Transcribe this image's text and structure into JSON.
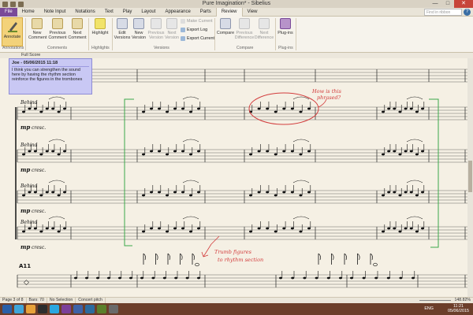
{
  "window": {
    "title": "Pure Imagination* - Sibelius",
    "controls": [
      "—",
      "□",
      "✕"
    ]
  },
  "tabs": [
    "File",
    "Home",
    "Note Input",
    "Notations",
    "Text",
    "Play",
    "Layout",
    "Appearance",
    "Parts",
    "Review",
    "View"
  ],
  "active_tab": "Review",
  "search": {
    "placeholder": "Find in ribbon"
  },
  "ribbon": {
    "annotate": "Annotate",
    "new_comment": [
      "New",
      "Comment"
    ],
    "previous_comment": [
      "Previous",
      "Comment"
    ],
    "next_comment": [
      "Next",
      "Comment"
    ],
    "highlight": "Highlight",
    "edit_versions": [
      "Edit",
      "Versions"
    ],
    "new_version": [
      "New",
      "Version"
    ],
    "previous_version": [
      "Previous",
      "Version"
    ],
    "next_version": [
      "Next",
      "Version"
    ],
    "make_current": "Make Current",
    "export_log": "Export Log",
    "export_current": "Export Current",
    "compare": "Compare",
    "previous_difference": [
      "Previous",
      "Difference"
    ],
    "next_difference": [
      "Next",
      "Difference"
    ],
    "plugins": "Plug-ins",
    "groups": [
      "Annotations",
      "Comments",
      "Highlights",
      "Versions",
      "Compare",
      "Plug-ins"
    ]
  },
  "document_tab": "Full Score",
  "comment": {
    "author_date": "Joe - 05/06/2015 11:18",
    "text": "I think you can strengthen the sound here by having the rhythm section reinforce the figures in the trombones"
  },
  "score": {
    "staff_directions": [
      "Behind",
      "Behind",
      "Behind",
      "Behind"
    ],
    "dynamics": [
      "mp",
      "cresc."
    ],
    "rehearsal_mark": "A11",
    "annotations": {
      "question": [
        "How is this",
        "phrased?"
      ],
      "instruction": [
        "Trumb figures",
        "to rhythm section"
      ]
    }
  },
  "status": {
    "page": "Page 3 of 8",
    "bars": "Bars: 70",
    "selection": "No Selection",
    "pitch": "Concert pitch",
    "zoom": "148.82%"
  },
  "taskbar": {
    "time": "11:21",
    "date": "05/06/2015",
    "lang": "ENG",
    "colors": [
      "#2a5fa8",
      "#3fa5d9",
      "#e8a23a",
      "#2d2d2d",
      "#2aa7e0",
      "#7b3f99",
      "#3e62a6",
      "#2c6b9e",
      "#5b7f2b",
      "#6a6a6a"
    ]
  },
  "colors": {
    "accent": "#7a4a99",
    "annotate": "#f3d27a",
    "comment": "#c9c8f4",
    "ink_red": "#d23c3c",
    "ink_green": "#3aa84a",
    "taskbar": "#6c3e2a"
  }
}
